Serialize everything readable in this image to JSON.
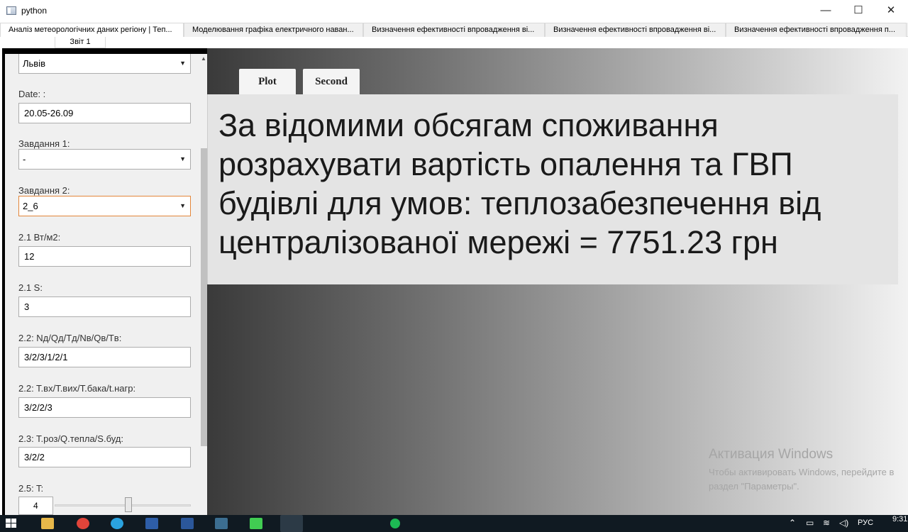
{
  "window": {
    "title": "python",
    "min": "—",
    "max": "☐",
    "close": "✕"
  },
  "tabs": [
    {
      "label": "Аналіз метеорологічних даних регіону | Теп..."
    },
    {
      "label": "Моделювання графіка електричного наван..."
    },
    {
      "label": "Визначення ефективності впровадження ві..."
    },
    {
      "label": "Визначення ефективності впровадження ві..."
    },
    {
      "label": "Визначення ефективності впровадження п..."
    }
  ],
  "subtab": {
    "label": "Звіт 1"
  },
  "sidebar": {
    "city": "Львів",
    "date_label": "Date: :",
    "date_value": "20.05-26.09",
    "task1_label": "Завдання 1:",
    "task1_value": "-",
    "task2_label": "Завдання 2:",
    "task2_value": "2_6",
    "p21_label": "2.1 Вт/м2:",
    "p21_value": "12",
    "s21_label": "2.1 S:",
    "s21_value": "3",
    "p22a_label": "2.2: Nд/Qд/Tд/Nв/Qв/Tв:",
    "p22a_value": "3/2/3/1/2/1",
    "p22b_label": "2.2: T.вх/T.вих/T.бака/t.нагр:",
    "p22b_value": "3/2/2/3",
    "p23_label": "2.3: T.роз/Q.тепла/S.буд:",
    "p23_value": "3/2/2",
    "t25_label": "2.5: T:",
    "t25_value": "4",
    "t25_slider_fraction": 0.55
  },
  "plot_tabs": {
    "plot": "Plot",
    "second": "Second"
  },
  "result_text": "За відомими обсягам споживання розрахувати вартість опалення та ГВП будівлі для умов: теплозабезпечення від централізованої мережі = 7751.23 грн",
  "watermark": {
    "title": "Активация Windows",
    "line1": "Чтобы активировать Windows, перейдите в",
    "line2": "раздел \"Параметры\"."
  },
  "taskbar": {
    "lang": "РУС",
    "time": "9:31"
  }
}
